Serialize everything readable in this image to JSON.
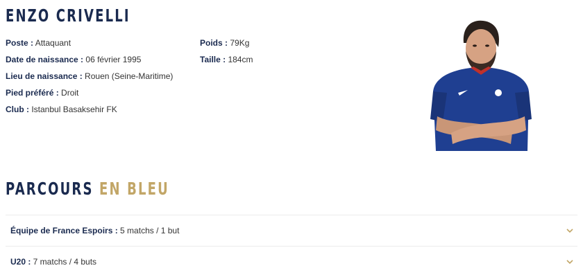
{
  "player": {
    "name": "ENZO CRIVELLI"
  },
  "details": {
    "poste_label": "Poste :",
    "poste_value": " Attaquant",
    "dob_label": "Date de naissance :",
    "dob_value": " 06 février 1995",
    "birthplace_label": "Lieu de naissance :",
    "birthplace_value": " Rouen (Seine-Maritime)",
    "foot_label": "Pied préféré :",
    "foot_value": " Droit",
    "club_label": "Club :",
    "club_value": " Istanbul Basaksehir FK",
    "weight_label": "Poids :",
    "weight_value": " 79Kg",
    "height_label": "Taille :",
    "height_value": " 184cm"
  },
  "section": {
    "title_main": "PARCOURS ",
    "title_accent": "EN BLEU"
  },
  "career": [
    {
      "label": "Équipe de France Espoirs :",
      "value": " 5 matchs / 1 but"
    },
    {
      "label": "U20 :",
      "value": " 7 matchs / 4 buts"
    }
  ],
  "colors": {
    "navy": "#1a2a4f",
    "gold": "#c2a667",
    "jersey": "#1f3f91"
  }
}
